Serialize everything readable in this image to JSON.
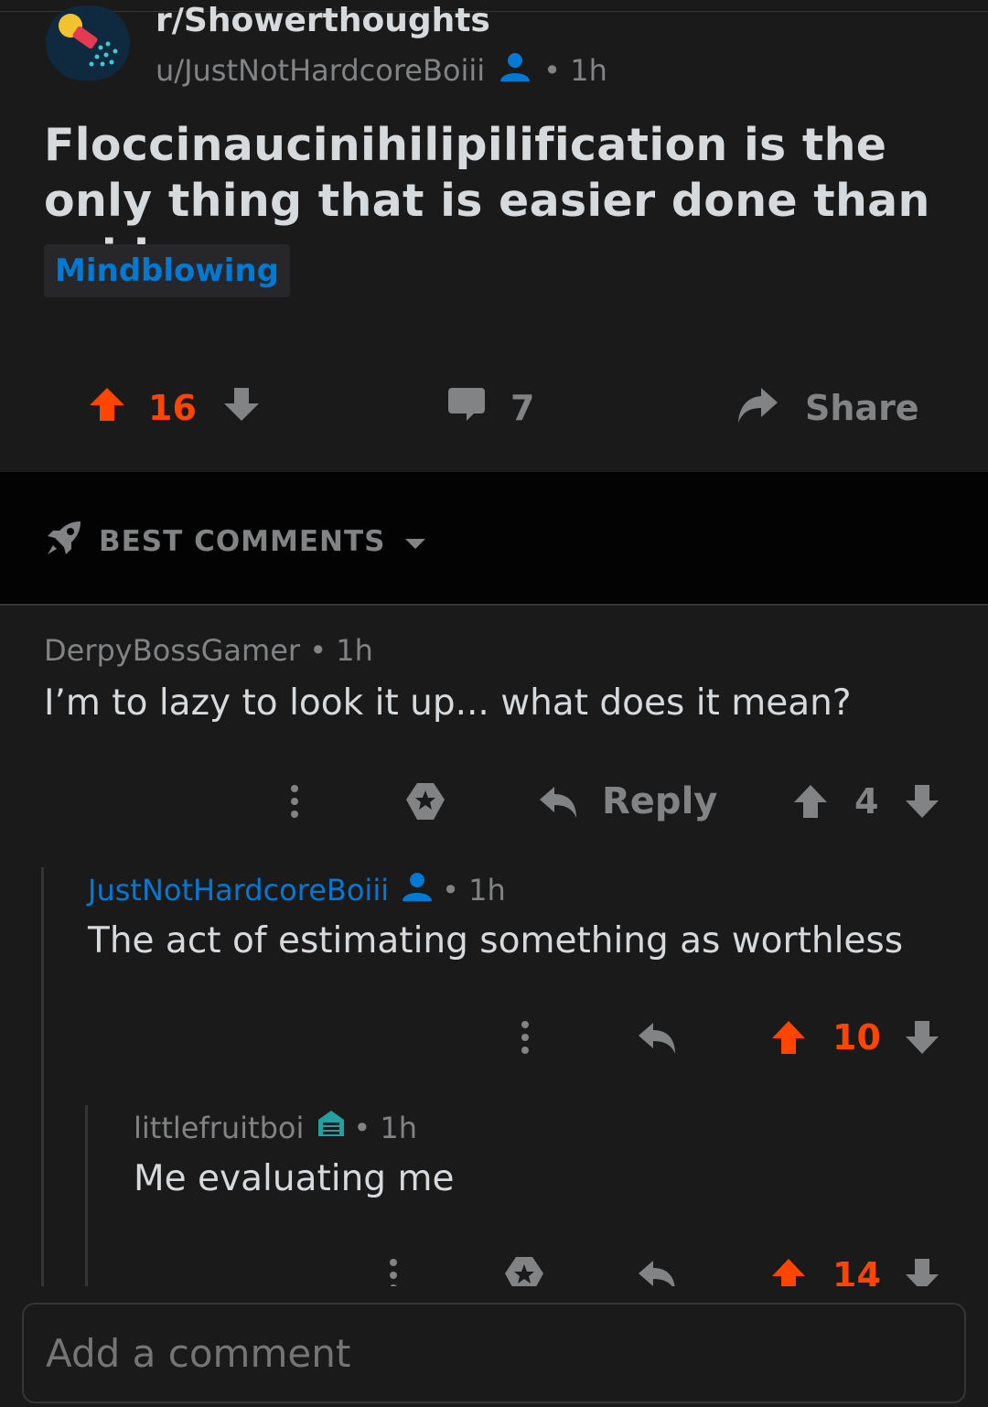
{
  "post": {
    "subreddit": "r/Showerthoughts",
    "author": "u/JustNotHardcoreBoiii",
    "time": "1h",
    "title": "Floccinaucinihilipilification is the only thing that is easier done than said.",
    "flair": "Mindblowing",
    "score": "16",
    "comments_count": "7",
    "share_label": "Share"
  },
  "sort": {
    "label": "BEST COMMENTS"
  },
  "comments": [
    {
      "author": "DerpyBossGamer",
      "time": "1h",
      "body": "I’m to lazy to look it up... what does it mean?",
      "reply_label": "Reply",
      "score": "4"
    },
    {
      "author": "JustNotHardcoreBoiii",
      "time": "1h",
      "body": "The act of estimating something as worthless",
      "score": "10"
    },
    {
      "author": "littlefruitboi",
      "time": "1h",
      "body": "Me evaluating me",
      "score": "14"
    }
  ],
  "composer": {
    "placeholder": "Add a comment"
  },
  "colors": {
    "background": "#1a1a1b",
    "upvote": "#ff4500",
    "op_blue": "#0079d3",
    "muted": "#818384",
    "text": "#d7dadc",
    "flair_badge": "#24a0a0"
  },
  "icons": [
    "subreddit-avatar",
    "user-icon",
    "upvote-arrow-icon",
    "downvote-arrow-icon",
    "comment-bubble-icon",
    "share-arrow-icon",
    "rocket-icon",
    "chevron-down-icon",
    "more-dots-icon",
    "award-icon",
    "reply-arrow-icon",
    "flair-badge-icon"
  ]
}
